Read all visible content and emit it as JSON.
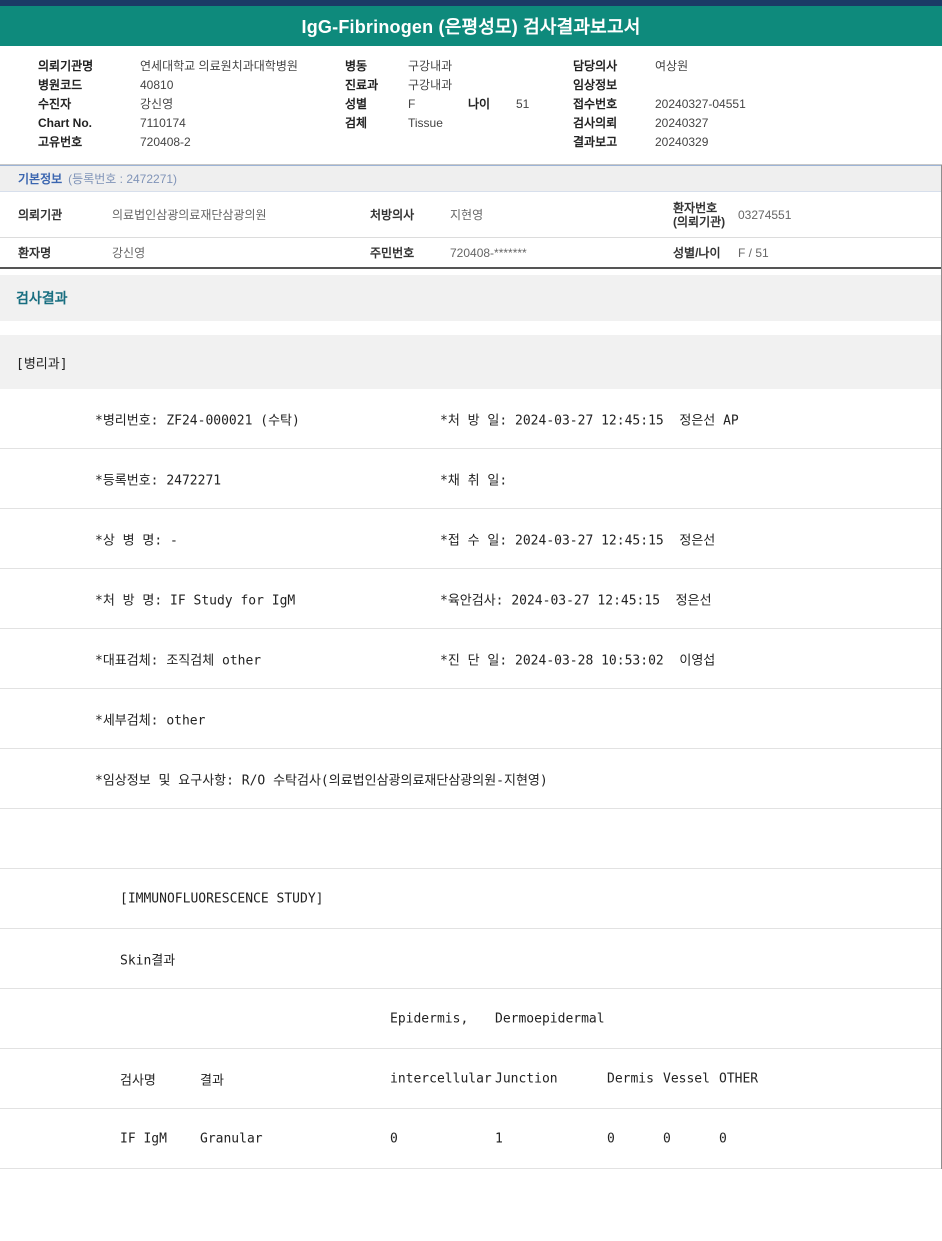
{
  "title": "IgG-Fibrinogen (은평성모) 검사결과보고서",
  "colors": {
    "top_strip": "#1B3A66",
    "banner": "#0E8A7C",
    "basic_info_title": "#3B66B0",
    "section_title": "#186E80"
  },
  "header": {
    "col1": [
      {
        "label": "의뢰기관명",
        "value": "연세대학교 의료원치과대학병원"
      },
      {
        "label": "병원코드",
        "value": "40810"
      },
      {
        "label": "수진자",
        "value": "강신영"
      },
      {
        "label": "Chart No.",
        "value": "7110174"
      },
      {
        "label": "고유번호",
        "value": "720408-2"
      }
    ],
    "col2": [
      {
        "label": "병동",
        "value": "구강내과"
      },
      {
        "label": "진료과",
        "value": "구강내과"
      },
      {
        "label": "성별",
        "value": "F",
        "label2": "나이",
        "value2": "51"
      },
      {
        "label": "검체",
        "value": "Tissue"
      }
    ],
    "col3": [
      {
        "label": "담당의사",
        "value": "여상원"
      },
      {
        "label": "임상정보",
        "value": ""
      },
      {
        "label": "접수번호",
        "value": "20240327-04551"
      },
      {
        "label": "검사의뢰",
        "value": "20240327"
      },
      {
        "label": "결과보고",
        "value": "20240329"
      }
    ]
  },
  "basic_info": {
    "bar_title": "기본정보",
    "bar_sub": "(등록번호 : 2472271)",
    "row1": {
      "l1": "의뢰기관",
      "v1": "의료법인삼광의료재단삼광의원",
      "l2": "처방의사",
      "v2": "지현영",
      "l3a": "환자번호",
      "l3b": "(의뢰기관)",
      "v3": "03274551"
    },
    "row2": {
      "l1": "환자명",
      "v1": "강신영",
      "l2": "주민번호",
      "v2": "720408-*******",
      "l3": "성별/나이",
      "v3": "F / 51"
    }
  },
  "results": {
    "section_title": "검사결과",
    "dept": "[병리과]",
    "pathology_rows": [
      {
        "left": "*병리번호: ZF24-000021 (수탁)",
        "right": "*처 방 일: 2024-03-27 12:45:15  정은선 AP"
      },
      {
        "left": "*등록번호: 2472271",
        "right": "*채 취 일:"
      },
      {
        "left": "*상 병 명: -",
        "right": "*접 수 일: 2024-03-27 12:45:15  정은선"
      },
      {
        "left": "*처 방 명: IF Study for IgM",
        "right": "*육안검사: 2024-03-27 12:45:15  정은선"
      },
      {
        "left": "*대표검체: 조직검체 other",
        "right": "*진 단 일: 2024-03-28 10:53:02  이영섭"
      },
      {
        "left": "*세부검체: other",
        "right": ""
      },
      {
        "left": "*임상정보 및 요구사항: R/O 수탁검사(의료법인삼광의료재단삼광의원-지현영)",
        "right": ""
      }
    ],
    "if_study": {
      "title": "[IMMUNOFLUORESCENCE STUDY]",
      "subtitle": "Skin결과",
      "header_top": [
        "Epidermis,",
        "Dermoepidermal"
      ],
      "header_cols": [
        "검사명",
        "결과",
        "intercellular",
        "Junction",
        "Dermis",
        "Vessel",
        "OTHER"
      ],
      "data_row": [
        "IF IgM",
        "Granular",
        "0",
        "1",
        "0",
        "0",
        "0"
      ]
    }
  }
}
